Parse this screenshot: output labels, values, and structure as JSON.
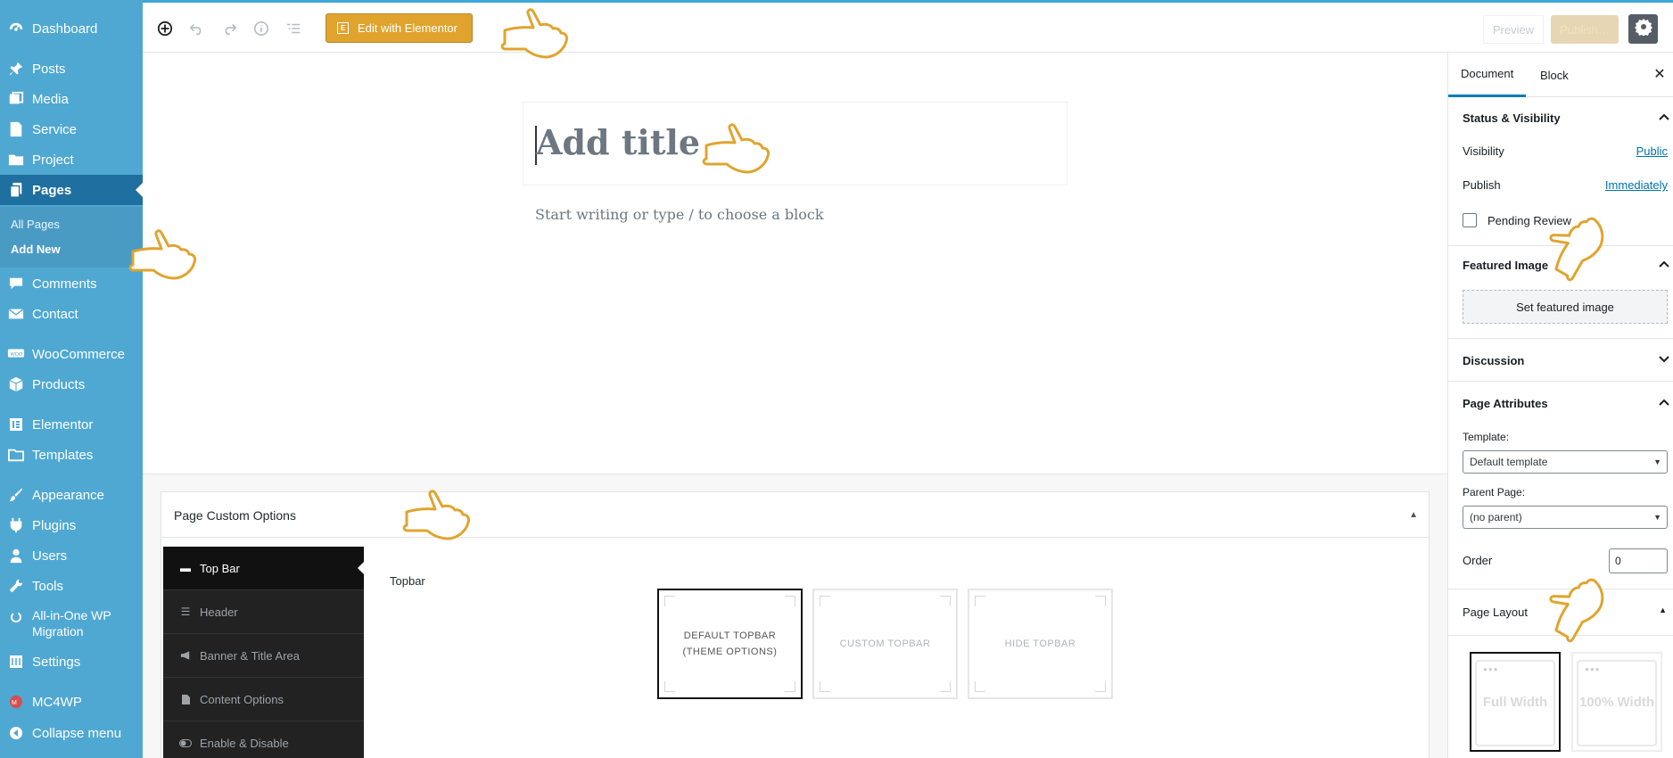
{
  "admin_menu": {
    "items": [
      {
        "label": "Dashboard",
        "icon": "dashboard-icon"
      },
      {
        "label": "Posts",
        "icon": "pin-icon"
      },
      {
        "label": "Media",
        "icon": "media-icon"
      },
      {
        "label": "Service",
        "icon": "page-icon"
      },
      {
        "label": "Project",
        "icon": "folder-icon"
      },
      {
        "label": "Pages",
        "icon": "pages-icon"
      },
      {
        "label": "Comments",
        "icon": "comment-icon"
      },
      {
        "label": "Contact",
        "icon": "mail-icon"
      },
      {
        "label": "WooCommerce",
        "icon": "woo-icon"
      },
      {
        "label": "Products",
        "icon": "box-icon"
      },
      {
        "label": "Elementor",
        "icon": "elementor-icon"
      },
      {
        "label": "Templates",
        "icon": "folder-icon"
      },
      {
        "label": "Appearance",
        "icon": "brush-icon"
      },
      {
        "label": "Plugins",
        "icon": "plug-icon"
      },
      {
        "label": "Users",
        "icon": "user-icon"
      },
      {
        "label": "Tools",
        "icon": "wrench-icon"
      },
      {
        "label": "All-in-One WP\nMigration",
        "icon": "migration-icon"
      },
      {
        "label": "Settings",
        "icon": "sliders-icon"
      },
      {
        "label": "MC4WP",
        "icon": "mc4wp-icon"
      },
      {
        "label": "Collapse menu",
        "icon": "collapse-icon"
      }
    ],
    "current": "Pages",
    "submenu": [
      "All Pages",
      "Add New"
    ],
    "submenu_active": "Add New"
  },
  "toolbar": {
    "elementor_label": "Edit with Elementor",
    "preview_label": "Preview",
    "publish_label": "Publish…"
  },
  "editor": {
    "title_placeholder": "Add title",
    "body_placeholder": "Start writing or type / to choose a block"
  },
  "metabox": {
    "title": "Page Custom Options",
    "tabs": [
      "Top Bar",
      "Header",
      "Banner & Title Area",
      "Content Options",
      "Enable & Disable"
    ],
    "active_tab": "Top Bar",
    "field_label": "Topbar",
    "choices": [
      "DEFAULT TOPBAR\n(THEME OPTIONS)",
      "CUSTOM TOPBAR",
      "HIDE TOPBAR"
    ],
    "selected_choice": "DEFAULT TOPBAR\n(THEME OPTIONS)"
  },
  "sidebar": {
    "tabs": [
      "Document",
      "Block"
    ],
    "active_tab": "Document",
    "status": {
      "heading": "Status & Visibility",
      "visibility_label": "Visibility",
      "visibility_value": "Public",
      "publish_label": "Publish",
      "publish_value": "Immediately",
      "pending_label": "Pending Review"
    },
    "featured": {
      "heading": "Featured Image",
      "button": "Set featured image"
    },
    "discussion": {
      "heading": "Discussion"
    },
    "attributes": {
      "heading": "Page Attributes",
      "template_label": "Template:",
      "template_value": "Default template",
      "parent_label": "Parent Page:",
      "parent_value": "(no parent)",
      "order_label": "Order",
      "order_value": "0"
    },
    "layout": {
      "heading": "Page Layout",
      "options": [
        "Full Width",
        "100% Width"
      ],
      "selected": "Full Width"
    }
  },
  "colors": {
    "admin_bg": "#4fa8d2",
    "admin_current": "#1f6fa0",
    "elementor": "#e0a42e",
    "hand": "#e0a42e",
    "link": "#0073aa"
  }
}
